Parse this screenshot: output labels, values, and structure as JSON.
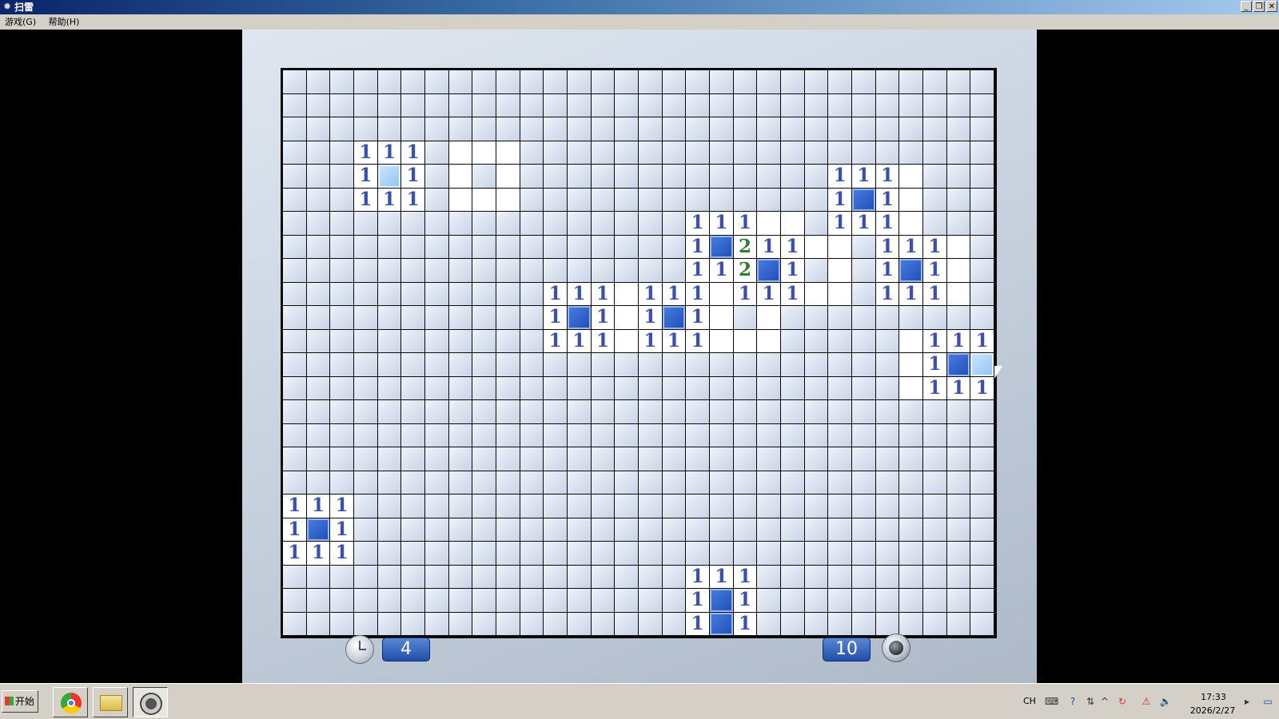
{
  "window": {
    "title": "扫雷",
    "controls": [
      "_",
      "❐",
      "✕"
    ]
  },
  "menu": [
    {
      "label": "游戏(G)"
    },
    {
      "label": "帮助(H)"
    }
  ],
  "game": {
    "cols": 30,
    "rows": 24,
    "timer": "4",
    "mines_remaining": "10"
  },
  "board": {
    "revealed_rows": [
      "............................",
      "............................",
      "............................",
      ".......111..................",
      ".......1.1..............111.",
      ".......111..............1.1.",
      "...................111..111.",
      "...................1.211..111",
      "...................112.1..1.1",
      "..............111.111111..111",
      "..............1.1.1.1........",
      "..............111.111.....111",
      "..........................1..",
      "..........................111",
      ".............................",
      ".............................",
      ".............................",
      ".............................",
      "111..........................",
      "1.1..........................",
      "111..........................",
      ".................111.........",
      ".................1.1.........",
      ".................1.1........."
    ],
    "numbers": [
      [
        3,
        3,
        "1"
      ],
      [
        3,
        4,
        "1"
      ],
      [
        3,
        5,
        "1"
      ],
      [
        4,
        3,
        "1"
      ],
      [
        4,
        5,
        "1"
      ],
      [
        5,
        3,
        "1"
      ],
      [
        5,
        4,
        "1"
      ],
      [
        5,
        5,
        "1"
      ],
      [
        4,
        23,
        "1"
      ],
      [
        4,
        24,
        "1"
      ],
      [
        4,
        25,
        "1"
      ],
      [
        5,
        23,
        "1"
      ],
      [
        5,
        25,
        "1"
      ],
      [
        6,
        23,
        "1"
      ],
      [
        6,
        24,
        "1"
      ],
      [
        6,
        25,
        "1"
      ],
      [
        6,
        17,
        "1"
      ],
      [
        6,
        18,
        "1"
      ],
      [
        6,
        19,
        "1"
      ],
      [
        7,
        17,
        "1"
      ],
      [
        7,
        19,
        "2"
      ],
      [
        7,
        20,
        "1"
      ],
      [
        7,
        21,
        "1"
      ],
      [
        8,
        17,
        "1"
      ],
      [
        8,
        18,
        "1"
      ],
      [
        8,
        19,
        "2"
      ],
      [
        8,
        21,
        "1"
      ],
      [
        9,
        19,
        "1"
      ],
      [
        9,
        20,
        "1"
      ],
      [
        9,
        21,
        "1"
      ],
      [
        7,
        25,
        "1"
      ],
      [
        7,
        26,
        "1"
      ],
      [
        7,
        27,
        "1"
      ],
      [
        8,
        25,
        "1"
      ],
      [
        8,
        27,
        "1"
      ],
      [
        9,
        25,
        "1"
      ],
      [
        9,
        26,
        "1"
      ],
      [
        9,
        27,
        "1"
      ],
      [
        9,
        11,
        "1"
      ],
      [
        9,
        12,
        "1"
      ],
      [
        9,
        13,
        "1"
      ],
      [
        10,
        11,
        "1"
      ],
      [
        10,
        13,
        "1"
      ],
      [
        11,
        11,
        "1"
      ],
      [
        11,
        12,
        "1"
      ],
      [
        11,
        13,
        "1"
      ],
      [
        9,
        15,
        "1"
      ],
      [
        9,
        16,
        "1"
      ],
      [
        9,
        17,
        "1"
      ],
      [
        10,
        15,
        "1"
      ],
      [
        10,
        17,
        "1"
      ],
      [
        11,
        15,
        "1"
      ],
      [
        11,
        16,
        "1"
      ],
      [
        11,
        17,
        "1"
      ],
      [
        11,
        27,
        "1"
      ],
      [
        11,
        28,
        "1"
      ],
      [
        11,
        29,
        "1"
      ],
      [
        12,
        27,
        "1"
      ],
      [
        13,
        27,
        "1"
      ],
      [
        13,
        28,
        "1"
      ],
      [
        13,
        29,
        "1"
      ],
      [
        18,
        0,
        "1"
      ],
      [
        18,
        1,
        "1"
      ],
      [
        18,
        2,
        "1"
      ],
      [
        19,
        0,
        "1"
      ],
      [
        19,
        2,
        "1"
      ],
      [
        20,
        0,
        "1"
      ],
      [
        20,
        1,
        "1"
      ],
      [
        20,
        2,
        "1"
      ],
      [
        21,
        17,
        "1"
      ],
      [
        21,
        18,
        "1"
      ],
      [
        21,
        19,
        "1"
      ],
      [
        22,
        17,
        "1"
      ],
      [
        22,
        19,
        "1"
      ],
      [
        23,
        17,
        "1"
      ],
      [
        23,
        19,
        "1"
      ]
    ],
    "mines": [
      [
        4,
        4,
        "hover"
      ],
      [
        5,
        24,
        ""
      ],
      [
        7,
        18,
        ""
      ],
      [
        8,
        20,
        ""
      ],
      [
        8,
        26,
        ""
      ],
      [
        10,
        12,
        ""
      ],
      [
        10,
        16,
        ""
      ],
      [
        12,
        28,
        ""
      ],
      [
        12,
        29,
        "hover"
      ],
      [
        19,
        1,
        ""
      ],
      [
        22,
        18,
        ""
      ],
      [
        23,
        18,
        ""
      ]
    ],
    "colors": {
      "1": "#3b4fb0",
      "2": "#2e7d32"
    }
  },
  "taskbar": {
    "start_label": "开始",
    "apps": [
      "chrome-icon",
      "folder-icon",
      "minesweeper-icon"
    ],
    "ime": "CH",
    "time": "17:33",
    "date": "2026/2/27"
  }
}
